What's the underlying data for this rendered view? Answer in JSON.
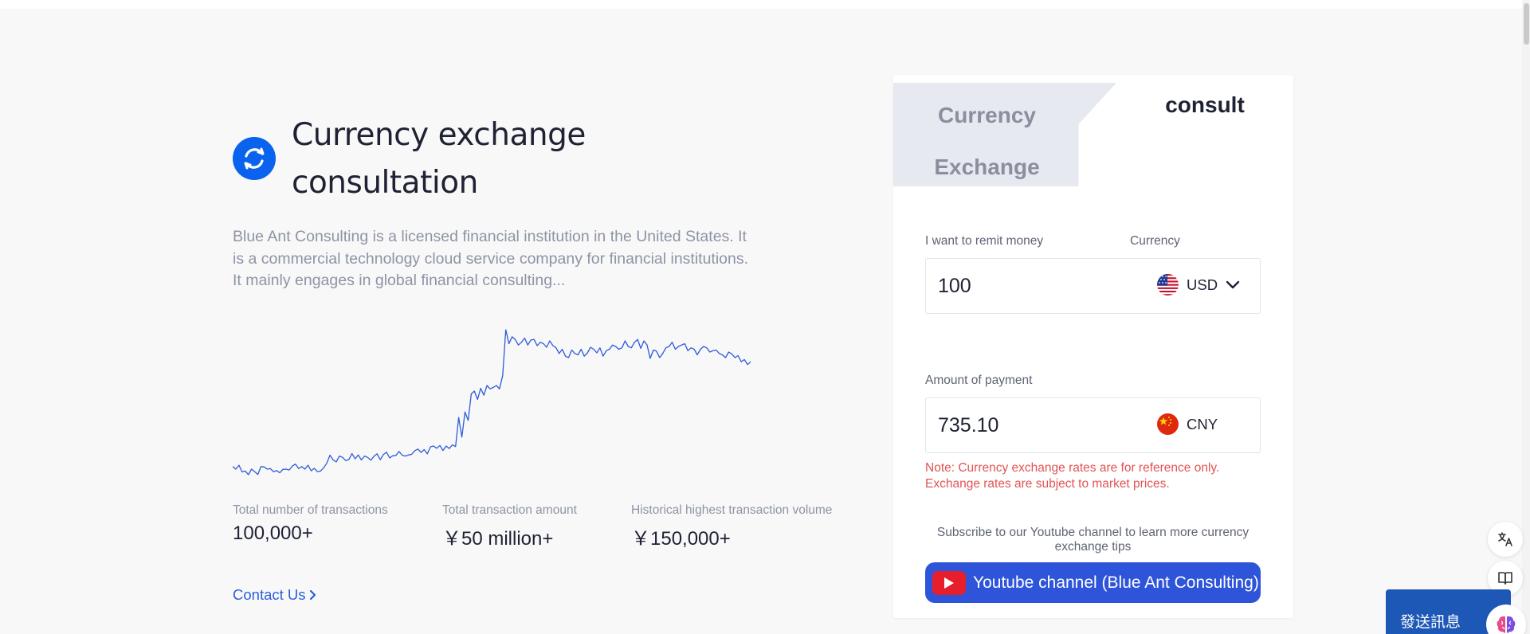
{
  "hero": {
    "title": "Currency exchange consultation",
    "description": "Blue Ant Consulting is a licensed financial institution in the United States. It is a commercial technology cloud service company for financial institutions. It mainly engages in global financial consulting..."
  },
  "stats": [
    {
      "label": "Total number of transactions",
      "value": "100,000+"
    },
    {
      "label": "Total transaction amount",
      "value": "￥50 million+"
    },
    {
      "label": "Historical highest transaction volume",
      "value": "￥150,000+"
    }
  ],
  "contact_link": "Contact Us",
  "converter": {
    "tabs": [
      {
        "label": "Currency Exchange",
        "active": false
      },
      {
        "label": "consult",
        "active": true
      }
    ],
    "remit_label": "I want to remit money",
    "currency_label": "Currency",
    "remit_amount": "100",
    "remit_currency": "USD",
    "payment_label": "Amount of payment",
    "payment_amount": "735.10",
    "payment_currency": "CNY",
    "note": "Note: Currency exchange rates are for reference only. Exchange rates are subject to market prices.",
    "subscribe_text": "Subscribe to our Youtube channel to learn more currency exchange tips",
    "youtube_button": "Youtube channel (Blue Ant Consulting)"
  },
  "chat_widget": {
    "label": "發送訊息"
  },
  "icons": {
    "logo": "currency-exchange-icon",
    "translate": "translate-icon",
    "reader": "book-icon",
    "assistant": "brain-icon"
  },
  "colors": {
    "accent": "#0a63ec",
    "link": "#2b5fd9",
    "chart_line": "#2e5bd7",
    "note_red": "#e25353",
    "youtube_button": "#2e54da",
    "chat": "#1e58b7"
  },
  "chart_data": {
    "type": "line",
    "series": [
      {
        "values": [
          -1.36,
          -1.45,
          -1.31,
          -1.55,
          -1.52,
          -1.65,
          -1.45,
          -1.54,
          -1.64,
          -1.36,
          -1.37,
          -1.45,
          -1.43,
          -1.54,
          -1.5,
          -1.58,
          -1.46,
          -1.45,
          -1.48,
          -1.34,
          -1.27,
          -1.43,
          -1.36,
          -1.45,
          -1.31,
          -1.51,
          -1.42,
          -1.54,
          -1.52,
          -1.4,
          -1.23,
          -0.95,
          -1.12,
          -1.19,
          -0.98,
          -1.03,
          -1.14,
          -1.11,
          -0.89,
          -1.08,
          -0.94,
          -1.12,
          -0.98,
          -1.03,
          -1.13,
          -0.99,
          -0.9,
          -1.11,
          -0.93,
          -0.84,
          -1.05,
          -0.97,
          -0.96,
          -0.82,
          -0.95,
          -0.98,
          -0.94,
          -0.92,
          -0.79,
          -0.73,
          -0.85,
          -0.75,
          -0.9,
          -0.65,
          -0.62,
          -0.7,
          -0.6,
          -0.78,
          -0.62,
          -0.71,
          -0.58,
          -0.64,
          0.4,
          -0.3,
          0.6,
          0.3,
          1.25,
          1.35,
          1.05,
          1.45,
          1.2,
          1.55,
          1.43,
          1.48,
          1.55,
          1.43,
          1.9,
          3.55,
          3.05,
          3.3,
          3.2,
          3.0,
          3.1,
          3.25,
          3.0,
          3.18,
          3.2,
          2.98,
          3.1,
          3.05,
          2.92,
          3.15,
          2.98,
          2.9,
          2.7,
          2.85,
          2.6,
          2.55,
          2.82,
          2.7,
          2.65,
          2.85,
          2.6,
          2.72,
          2.92,
          2.85,
          2.72,
          2.9,
          2.6,
          2.8,
          2.85,
          3.0,
          2.95,
          2.85,
          2.9,
          3.15,
          2.95,
          2.9,
          3.1,
          3.2,
          2.88,
          3.15,
          3.0,
          2.52,
          2.82,
          2.78,
          2.55,
          2.7,
          2.9,
          2.95,
          3.1,
          2.85,
          2.95,
          3.0,
          3.05,
          2.8,
          2.9,
          2.85,
          2.65,
          2.85,
          2.95,
          2.9,
          2.75,
          2.8,
          2.82,
          2.7,
          2.65,
          2.55,
          2.75,
          2.68,
          2.55,
          2.62,
          2.4,
          2.48,
          2.3,
          2.4
        ]
      }
    ]
  }
}
